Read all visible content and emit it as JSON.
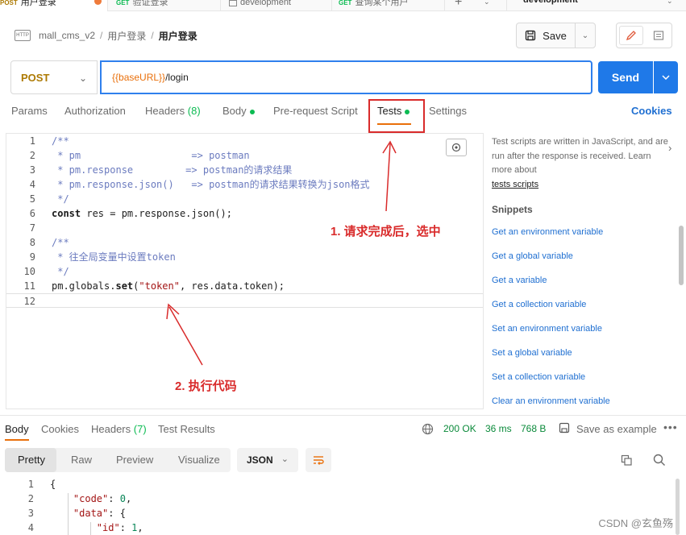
{
  "top_tabs": [
    {
      "method": "POST",
      "label": "用户登录",
      "active": true
    },
    {
      "method": "GET",
      "label": "验证登录"
    },
    {
      "method": "",
      "label": "development"
    },
    {
      "method": "GET",
      "label": "查询某个用户"
    }
  ],
  "env_selector": "development",
  "breadcrumb": {
    "icon_text": "HTTP",
    "collection": "mall_cms_v2",
    "folder": "用户登录",
    "request": "用户登录"
  },
  "save": {
    "label": "Save"
  },
  "request": {
    "method": "POST",
    "url_var": "{{baseURL}}",
    "url_path": "/login",
    "send_label": "Send"
  },
  "req_tabs": {
    "params": "Params",
    "authorization": "Authorization",
    "headers": "Headers",
    "headers_count": "(8)",
    "body": "Body",
    "prerequest": "Pre-request Script",
    "tests": "Tests",
    "settings": "Settings",
    "cookies": "Cookies"
  },
  "editor_lines": [
    {
      "n": "1",
      "text": "/**"
    },
    {
      "n": "2",
      "text": " * pm                   => postman"
    },
    {
      "n": "3",
      "text": " * pm.response         => postman的请求结果"
    },
    {
      "n": "4",
      "text": " * pm.response.json()   => postman的请求结果转换为json格式"
    },
    {
      "n": "5",
      "text": " */"
    },
    {
      "n": "6",
      "text": "const res = pm.response.json();"
    },
    {
      "n": "7",
      "text": ""
    },
    {
      "n": "8",
      "text": "/**"
    },
    {
      "n": "9",
      "text": " * 往全局变量中设置token"
    },
    {
      "n": "10",
      "text": " */"
    },
    {
      "n": "11",
      "text": "pm.globals.set(\"token\", res.data.token);"
    },
    {
      "n": "12",
      "text": ""
    }
  ],
  "side_panel": {
    "intro": "Test scripts are written in JavaScript, and are run after the response is received. Learn more about",
    "intro_link": "tests scripts",
    "snippets_title": "Snippets",
    "snippets": [
      "Get an environment variable",
      "Get a global variable",
      "Get a variable",
      "Get a collection variable",
      "Set an environment variable",
      "Set a global variable",
      "Set a collection variable",
      "Clear an environment variable"
    ]
  },
  "response": {
    "tabs": {
      "body": "Body",
      "cookies": "Cookies",
      "headers": "Headers",
      "headers_count": "(7)",
      "results": "Test Results"
    },
    "status": "200 OK",
    "time": "36 ms",
    "size": "768 B",
    "save_example": "Save as example",
    "formats": [
      "Pretty",
      "Raw",
      "Preview",
      "Visualize"
    ],
    "json_label": "JSON",
    "lines": [
      {
        "n": "1",
        "code": "{"
      },
      {
        "n": "2",
        "key": "\"code\"",
        "rest": ": 0,",
        "indent": "    "
      },
      {
        "n": "3",
        "key": "\"data\"",
        "rest": ": {",
        "indent": "    "
      },
      {
        "n": "4",
        "key": "\"id\"",
        "rest": ": 1,",
        "indent": "        "
      }
    ]
  },
  "annotations": {
    "step1": "1. 请求完成后，选中",
    "step2": "2. 执行代码",
    "color": "#d92b2b"
  },
  "watermark": "CSDN @玄鱼殇"
}
